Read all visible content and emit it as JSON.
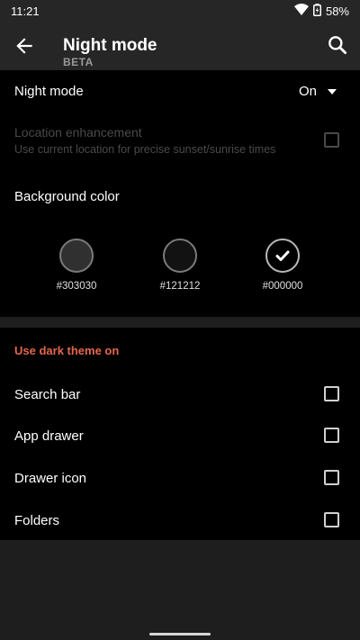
{
  "status_bar": {
    "time": "11:21",
    "battery": "58%"
  },
  "toolbar": {
    "title": "Night mode",
    "subtitle": "BETA"
  },
  "night_mode": {
    "label": "Night mode",
    "value": "On"
  },
  "location": {
    "title": "Location enhancement",
    "subtitle": "Use current location for precise sunset/sunrise times",
    "checked": false,
    "enabled": false
  },
  "background": {
    "label": "Background color",
    "swatches": [
      {
        "label": "#303030",
        "color": "#303030",
        "selected": false
      },
      {
        "label": "#121212",
        "color": "#121212",
        "selected": false
      },
      {
        "label": "#000000",
        "color": "#000000",
        "selected": true
      }
    ]
  },
  "dark_theme": {
    "header": "Use dark theme on",
    "options": [
      {
        "label": "Search bar",
        "checked": false
      },
      {
        "label": "App drawer",
        "checked": false
      },
      {
        "label": "Drawer icon",
        "checked": false
      },
      {
        "label": "Folders",
        "checked": false
      }
    ]
  },
  "colors": {
    "accent": "#e4674f",
    "background": "#000000",
    "toolbar": "#262626"
  },
  "icons": [
    "wifi-icon",
    "battery-icon",
    "back-arrow-icon",
    "search-icon",
    "dropdown-arrow-icon",
    "check-icon"
  ]
}
